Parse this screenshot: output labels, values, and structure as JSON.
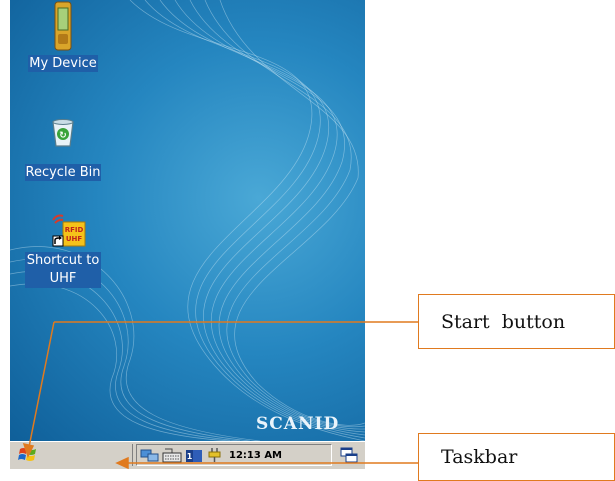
{
  "desktop": {
    "icons": [
      {
        "label": "My Device",
        "icon": "pda-device-icon"
      },
      {
        "label": "Recycle Bin",
        "icon": "recycle-bin-icon"
      },
      {
        "label_line1": "Shortcut to",
        "label_line2": "UHF",
        "icon": "rfid-uhf-shortcut-icon",
        "badge_line1": "RFID",
        "badge_line2": "UHF"
      }
    ],
    "brand": "SCANID"
  },
  "taskbar": {
    "clock": "12:13 AM",
    "tray_icons": [
      "network-icon",
      "keyboard-icon",
      "input-panel-icon",
      "power-plug-icon"
    ],
    "start_icon": "windows-flag-icon",
    "desktop_icon": "show-desktop-icon"
  },
  "annotations": {
    "start_button": "Start  button",
    "taskbar": "Taskbar",
    "line_color": "#e07a1f"
  },
  "colors": {
    "desktop_background": "#2586c0",
    "taskbar": "#d4d0c8",
    "icon_label_bg": "#1f5fa8"
  }
}
